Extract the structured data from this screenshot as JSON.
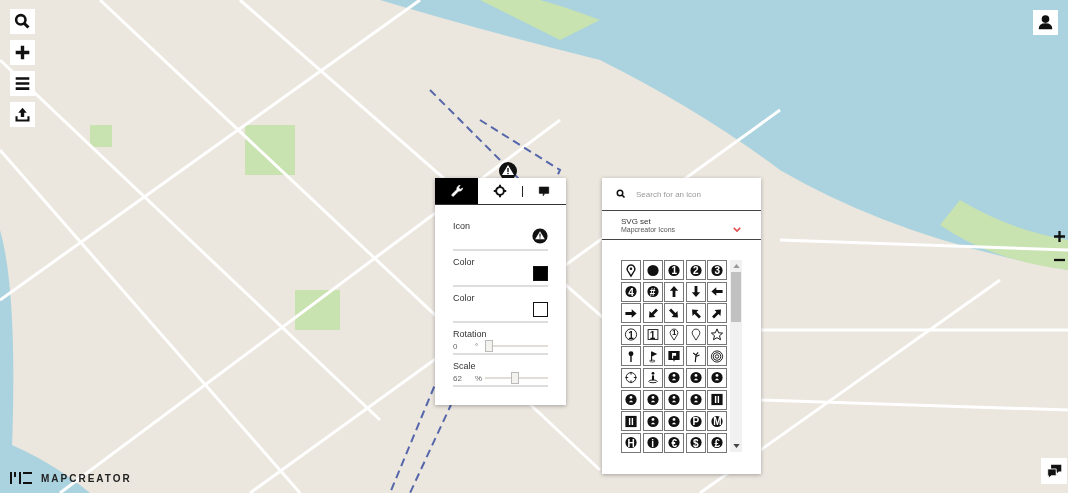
{
  "brand": {
    "name": "MAPCREATOR"
  },
  "properties_panel": {
    "tabs": [
      {
        "kind": "wrench",
        "selected": true
      },
      {
        "kind": "crosshair",
        "selected": false
      },
      {
        "kind": "comment",
        "selected": false
      }
    ],
    "fields": [
      {
        "kind": "icon",
        "label": "Icon"
      },
      {
        "kind": "swatch",
        "label": "Color",
        "color": "#000000"
      },
      {
        "kind": "swatch",
        "label": "Color",
        "color": "#ffffff"
      },
      {
        "kind": "slider",
        "label": "Rotation",
        "value": "0",
        "unit": "°",
        "level": 0
      },
      {
        "kind": "slider",
        "label": "Scale",
        "value": "62",
        "unit": "%",
        "level": 0.48
      }
    ]
  },
  "icon_picker": {
    "search": {
      "placeholder": "Search for an icon"
    },
    "svg_set": {
      "label": "SVG set",
      "value": "Mapcreator Icons"
    },
    "icons": [
      {
        "kind": "pin"
      },
      {
        "kind": "dot"
      },
      {
        "kind": "badge",
        "label": "1"
      },
      {
        "kind": "badge",
        "label": "2"
      },
      {
        "kind": "badge",
        "label": "3"
      },
      {
        "kind": "badge",
        "label": "4"
      },
      {
        "kind": "badge",
        "label": "#"
      },
      {
        "kind": "arrow-up"
      },
      {
        "kind": "arrow-down"
      },
      {
        "kind": "arrow-left"
      },
      {
        "kind": "arrow-right"
      },
      {
        "kind": "arrow-down-left"
      },
      {
        "kind": "arrow-down-right"
      },
      {
        "kind": "arrow-up-left"
      },
      {
        "kind": "arrow-up-right"
      },
      {
        "kind": "ring",
        "label": "1"
      },
      {
        "kind": "square",
        "label": "1"
      },
      {
        "kind": "pin-outline",
        "label": "1"
      },
      {
        "kind": "pin-outline"
      },
      {
        "kind": "star"
      },
      {
        "kind": "stickpin"
      },
      {
        "kind": "flag"
      },
      {
        "kind": "flag-square"
      },
      {
        "kind": "sprig"
      },
      {
        "kind": "target"
      },
      {
        "kind": "crosshair"
      },
      {
        "kind": "person-spot"
      },
      {
        "kind": "symbol"
      },
      {
        "kind": "symbol"
      },
      {
        "kind": "symbol"
      },
      {
        "kind": "symbol"
      },
      {
        "kind": "symbol"
      },
      {
        "kind": "symbol"
      },
      {
        "kind": "symbol"
      },
      {
        "kind": "tile"
      },
      {
        "kind": "tile"
      },
      {
        "kind": "symbol"
      },
      {
        "kind": "symbol"
      },
      {
        "kind": "badge",
        "label": "P"
      },
      {
        "kind": "badge",
        "label": "M"
      },
      {
        "kind": "badge",
        "label": "H"
      },
      {
        "kind": "badge",
        "label": "i"
      },
      {
        "kind": "badge",
        "label": "€"
      },
      {
        "kind": "badge",
        "label": "$"
      },
      {
        "kind": "badge",
        "label": "£"
      }
    ]
  }
}
